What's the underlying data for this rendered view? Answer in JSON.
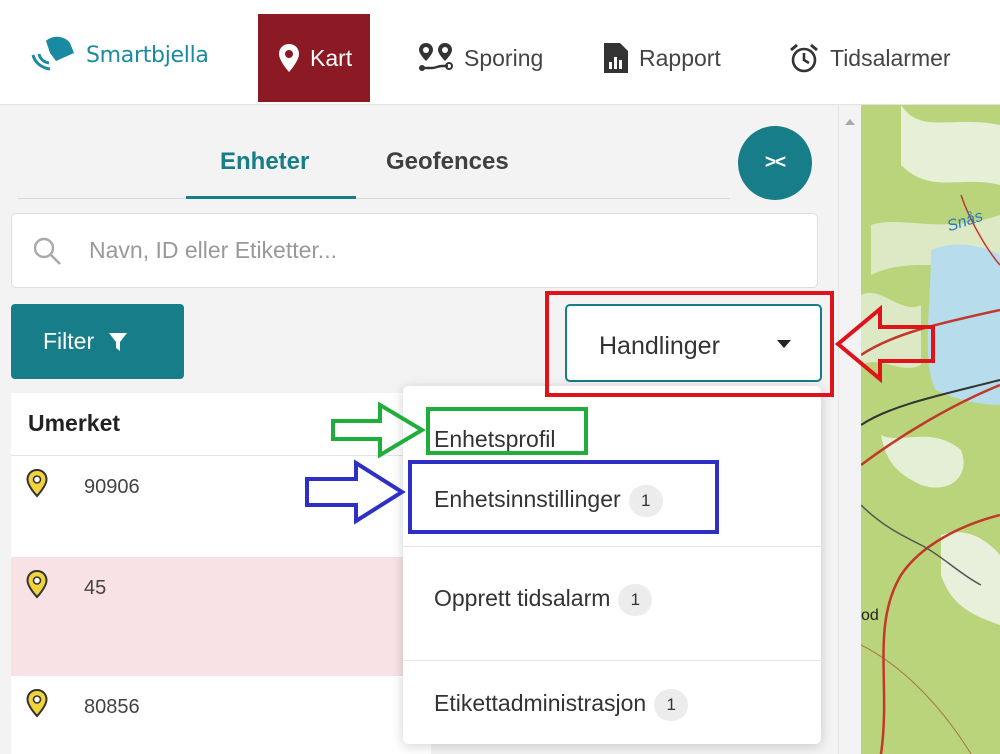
{
  "app": {
    "logo_text": "Smartbjella"
  },
  "nav": [
    {
      "label": "Kart",
      "icon": "map-pin-icon",
      "active": true
    },
    {
      "label": "Sporing",
      "icon": "tracking-icon"
    },
    {
      "label": "Rapport",
      "icon": "report-icon"
    },
    {
      "label": "Tidsalarmer",
      "icon": "alarm-clock-icon"
    }
  ],
  "sidebar": {
    "tabs": [
      {
        "label": "Enheter",
        "active": true
      },
      {
        "label": "Geofences"
      }
    ],
    "collapse_glyph": "><",
    "search": {
      "placeholder": "Navn, ID eller Etiketter..."
    },
    "filter_label": "Filter",
    "actions_label": "Handlinger",
    "units": {
      "header": "Umerket",
      "items": [
        {
          "id": "90906"
        },
        {
          "id": "45",
          "highlighted": true
        },
        {
          "id": "80856"
        }
      ]
    }
  },
  "actions_menu": [
    {
      "label": "Enhetsprofil"
    },
    {
      "label": "Enhetsinnstillinger",
      "badge": "1"
    },
    {
      "label": "Opprett tidsalarm",
      "badge": "1"
    },
    {
      "label": "Etikettadministrasjon",
      "badge": "1"
    }
  ],
  "map": {
    "labels": [
      "Snås",
      "od"
    ]
  },
  "colors": {
    "accent": "#177d88",
    "active_nav": "#8b1a24",
    "highlight_row": "#f8e2e5",
    "annotation_red": "#e0121a",
    "annotation_green": "#1fad3c",
    "annotation_blue": "#2e2fc4"
  }
}
